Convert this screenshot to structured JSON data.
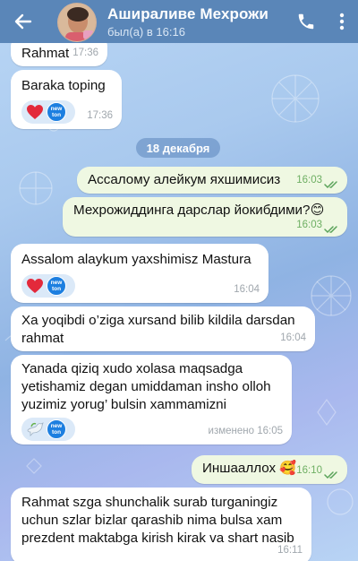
{
  "header": {
    "contact_name": "Ашираливе Мехрожи",
    "status": "был(а) в 16:16"
  },
  "icons": {
    "back": "arrow-left",
    "call": "phone",
    "menu": "more-vertical",
    "read": "double-check",
    "heart_reaction": "red-heart",
    "dove_reaction": "dove",
    "emoji_blush": "smiling-face",
    "emoji_hug": "hugging-face"
  },
  "colors": {
    "header": "#5a86b8",
    "incoming_bubble": "#ffffff",
    "outgoing_bubble": "#eff8e2",
    "outgoing_time": "#6eaf63",
    "badge": "#1d7fe0"
  },
  "badge_text": {
    "line1": "new",
    "line2": "ton"
  },
  "date_separator": "18 декабря",
  "messages": [
    {
      "direction": "in",
      "text": "Rahmat",
      "time": "17:36"
    },
    {
      "direction": "in",
      "text": "Baraka toping",
      "time": "17:36",
      "reactions": [
        "heart",
        "badge"
      ]
    },
    {
      "direction": "out",
      "text": "Ассалому алейкум яхшимисиз",
      "time": "16:03",
      "read": true
    },
    {
      "direction": "out",
      "text": "Мехрожиддинга дарслар йокибдими?",
      "emoji": "😊",
      "time": "16:03",
      "read": true
    },
    {
      "direction": "in",
      "text": "Assalom alaykum yaxshimisz Mastura",
      "time": "16:04",
      "reactions": [
        "heart",
        "badge"
      ]
    },
    {
      "direction": "in",
      "text_lines": [
        "Xa yoqibdi o’ziga xursand bilib kildila darsdan",
        "rahmat"
      ],
      "time": "16:04"
    },
    {
      "direction": "in",
      "text_lines": [
        "Yanada qiziq xudo xolasa maqsadga",
        "yetishamiz degan umiddaman insho olloh",
        "yuzimiz yorug’ bulsin xammamizni"
      ],
      "time": "16:05",
      "edited": "изменено",
      "reactions": [
        "dove",
        "badge"
      ]
    },
    {
      "direction": "out",
      "text": "Иншааллох",
      "emoji": "🥰",
      "time": "16:10",
      "read": true
    },
    {
      "direction": "in",
      "text_lines": [
        "Rahmat szga shunchalik surab turganingiz",
        "uchun szlar bizlar qarashib nima bulsa xam",
        "prezdent maktabga kirish kirak va shart nasib"
      ],
      "time": "16:11"
    }
  ]
}
